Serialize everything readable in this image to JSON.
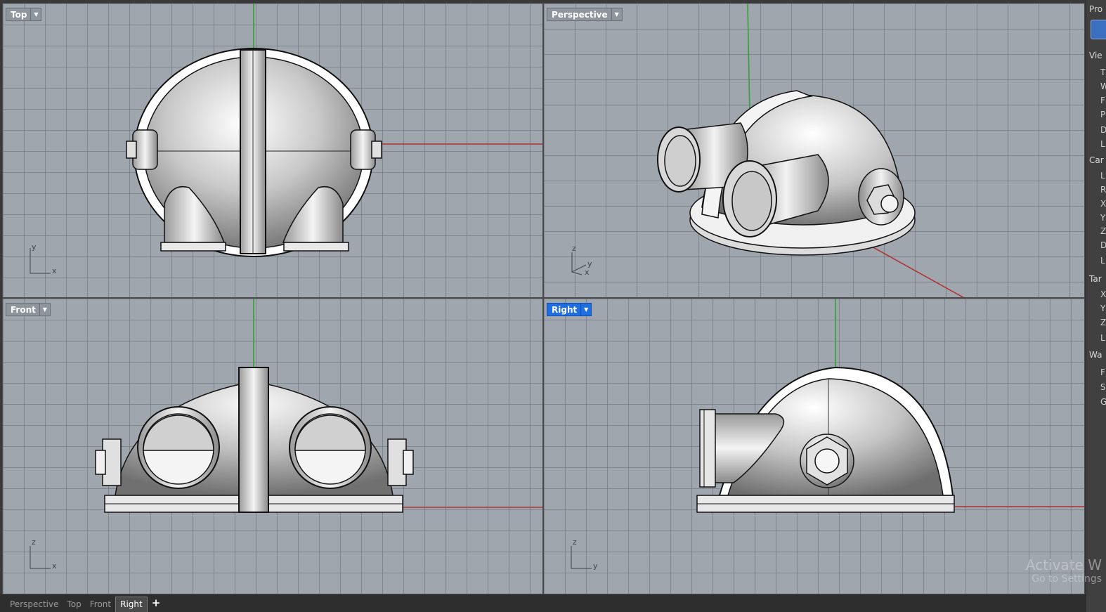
{
  "viewports": {
    "top": {
      "label": "Top",
      "axis_v": "y",
      "axis_h": "x"
    },
    "perspective": {
      "label": "Perspective",
      "axis_z": "z",
      "axis_y": "y",
      "axis_x": "x"
    },
    "front": {
      "label": "Front",
      "axis_v": "z",
      "axis_h": "x"
    },
    "right": {
      "label": "Right",
      "axis_v": "z",
      "axis_h": "y"
    }
  },
  "tabs": [
    {
      "label": "Perspective",
      "active": false
    },
    {
      "label": "Top",
      "active": false
    },
    {
      "label": "Front",
      "active": false
    },
    {
      "label": "Right",
      "active": true
    }
  ],
  "tab_add": "+",
  "active_viewport": "Right",
  "properties_panel": {
    "header": "Pro",
    "section_view": "Vie",
    "section_camera": "Car",
    "section_target": "Tar",
    "section_wallpaper": "Wa",
    "view_items": [
      "T",
      "W",
      "F",
      "P",
      "D",
      "L"
    ],
    "camera_items": [
      "L",
      "R",
      "X",
      "Y",
      "Z",
      "D",
      "L"
    ],
    "target_items": [
      "X",
      "Y",
      "Z",
      "L"
    ],
    "wallpaper_items": [
      "F",
      "S",
      "G"
    ]
  },
  "watermark": {
    "line1": "Activate W",
    "line2": "Go to Settings"
  },
  "colors": {
    "viewport_bg": "#a0a6ae",
    "active_label": "#1f6fe0",
    "x_axis": "#b03030",
    "y_axis": "#2fa02f"
  }
}
